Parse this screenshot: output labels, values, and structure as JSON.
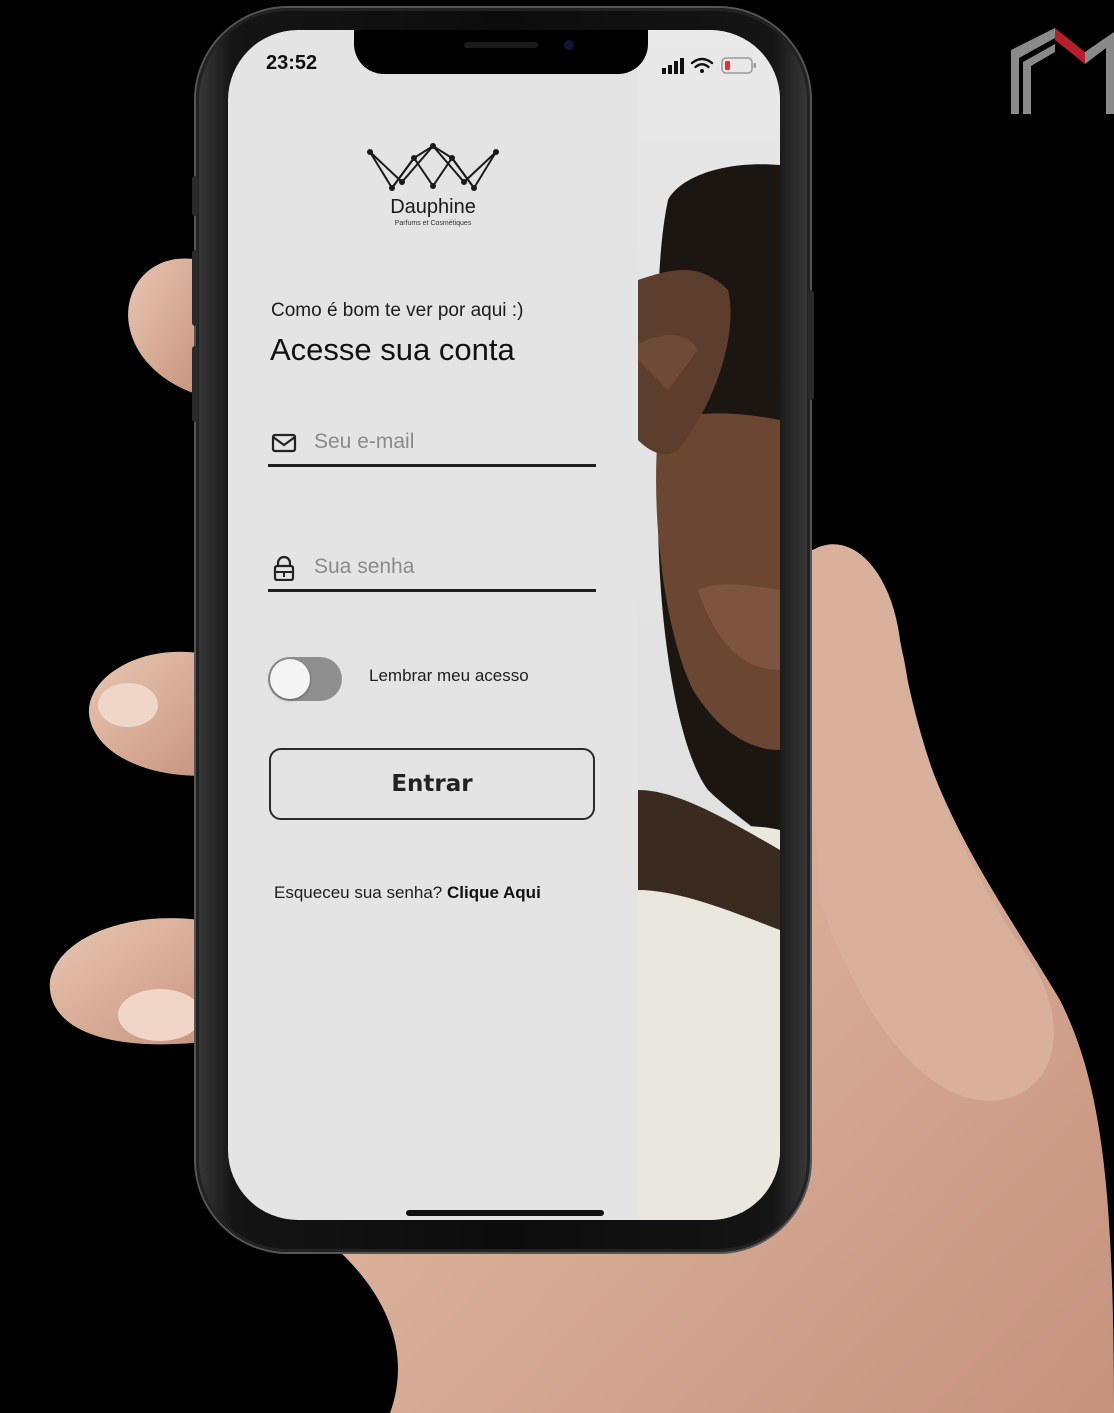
{
  "status": {
    "time": "23:52"
  },
  "brand": {
    "name": "Dauphine",
    "tagline": "Parfums et Cosmétiques"
  },
  "greeting": "Como é bom te ver por aqui :)",
  "headline": "Acesse sua conta",
  "email": {
    "placeholder": "Seu e-mail",
    "icon": "mail-icon"
  },
  "password": {
    "placeholder": "Sua senha",
    "icon": "lock-icon"
  },
  "remember": {
    "label": "Lembrar meu acesso",
    "enabled": false
  },
  "login_button": {
    "label": "Entrar"
  },
  "forgot": {
    "text": "Esqueceu sua senha?",
    "link": "Clique Aqui"
  },
  "colors": {
    "background": "#000000",
    "screen": "#e4e4e4",
    "accent_red": "#b3202a"
  }
}
